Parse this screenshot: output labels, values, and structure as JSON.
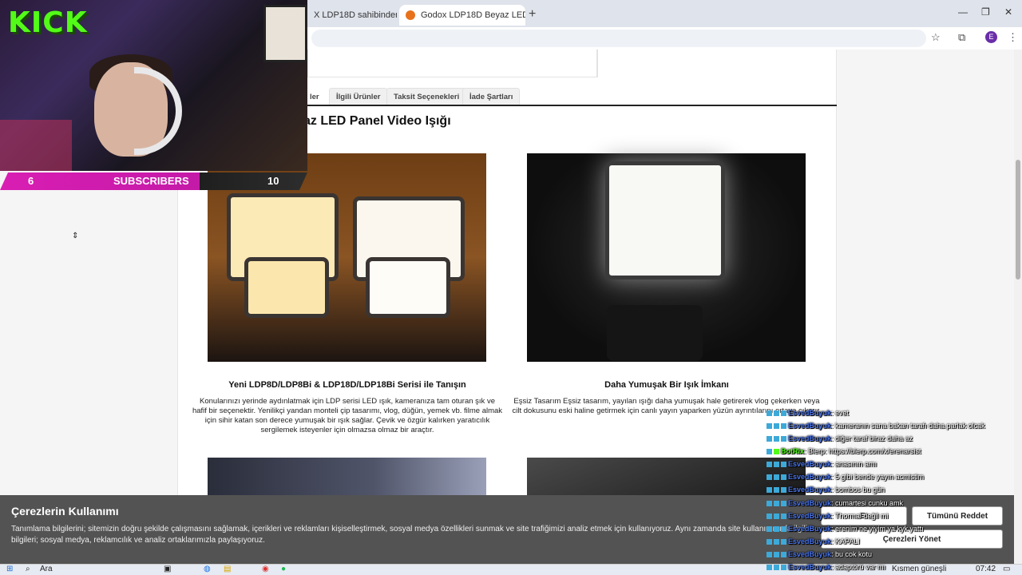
{
  "browser": {
    "tabs": [
      {
        "label": "X LDP18D sahibinden.co"
      },
      {
        "label": "Godox LDP18D Beyaz LED Pane"
      }
    ],
    "new_tab": "+",
    "avatar_letter": "E"
  },
  "page": {
    "tabs": [
      "ler",
      "İlgili Ürünler",
      "Taksit Seçenekleri",
      "İade Şartları"
    ],
    "product_title": "az LED Panel Video Işığı",
    "features": [
      {
        "title": "Yeni LDP8D/LDP8Bi & LDP18D/LDP18Bi Serisi ile Tanışın",
        "desc": "Konularınızı yerinde aydınlatmak için LDP serisi LED ışık, kameranıza tam oturan şık ve hafif bir seçenektir. Yenilikçi yandan monteli çip tasarımı, vlog, düğün, yemek vb. filme almak için sihir katan son derece yumuşak bir ışık sağlar. Çevik ve özgür kalırken yaratıcılık sergilemek isteyenler için olmazsa olmaz bir araçtır."
      },
      {
        "title": "Daha Yumuşak Bir Işık İmkanı",
        "desc": "Eşsiz Tasarım Eşsiz tasarım, yayılan ışığı daha yumuşak hale getirerek vlog çekerken veya cilt dokusunu eski haline getirmek için canlı yayın yaparken yüzün ayrıntılarını ortaya çıkarır."
      }
    ]
  },
  "overlay": {
    "logo": "KICK",
    "sub_left": "6",
    "sub_label": "SUBSCRIBERS",
    "sub_right": "10"
  },
  "chat": [
    {
      "user": "EsvedBuyuk",
      "msg": ": evet"
    },
    {
      "user": "EsvedBuyuk",
      "msg": ": kameranın sana bakan tarafı daha parlak olcak"
    },
    {
      "user": "EsvedBuyuk",
      "msg": ": diğer taraf biraz daha az"
    },
    {
      "user": "BotRix",
      "msg": ": Blerp: https://blerp.com/x/erenarsist",
      "bot": true
    },
    {
      "user": "EsvedBuyuk",
      "msg": ": anasının amı"
    },
    {
      "user": "EsvedBuyuk",
      "msg": ": 5 gibi bende yayın acmistim"
    },
    {
      "user": "EsvedBuyuk",
      "msg": ": bombos bu gün"
    },
    {
      "user": "EsvedBuyuk",
      "msg": ": cumartesi cunku amk"
    },
    {
      "user": "EsvedBuyuk",
      "msg": ": Thormal değil mi"
    },
    {
      "user": "EsvedBuyuk",
      "msg": ": erenim ne yiyim ya kyk yattı"
    },
    {
      "user": "EsvedBuyuk",
      "msg": ": KAPALI"
    },
    {
      "user": "EsvedBuyuk",
      "msg": ": bu cok kotu"
    },
    {
      "user": "EsvedBuyuk",
      "msg": ": adaptörü var mı"
    }
  ],
  "cookie": {
    "title": "Çerezlerin Kullanımı",
    "text": "Tanımlama bilgilerini; sitemizin doğru şekilde çalışmasını sağlamak, içerikleri ve reklamları kişiselleştirmek, sosyal medya özellikleri sunmak ve site trafiğimizi analiz etmek için kullanıyoruz. Aynı zamanda site kullanımınızla ilgili bilgileri; sosyal medya, reklamcılık ve analiz ortaklarımızla paylaşıyoruz.",
    "accept": "Et",
    "reject": "Tümünü Reddet",
    "manage": "Çerezleri Yönet"
  },
  "taskbar": {
    "search": "Ara",
    "weather": "Kısmen güneşli",
    "time": "07:42"
  }
}
